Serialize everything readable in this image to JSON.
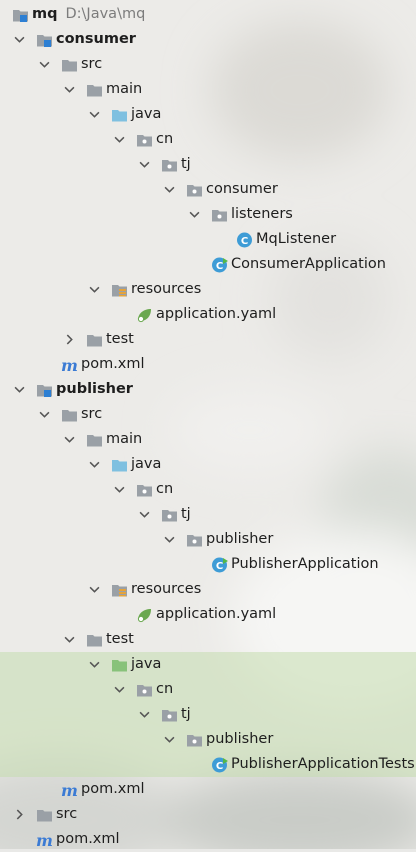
{
  "colors": {
    "folder_gray": "#9aa0a6",
    "source_blue": "#7fc0e0",
    "test_green": "#88c27a",
    "class_blue": "#3e9cd6",
    "spring_green": "#6aa84f",
    "maven_blue": "#3b7bd4",
    "highlight": "#cfe3bd"
  },
  "tree": {
    "root": {
      "label": "mq",
      "path": "D:\\Java\\mq"
    },
    "consumer": {
      "label": "consumer",
      "src": "src",
      "main": "main",
      "java": "java",
      "cn": "cn",
      "tj": "tj",
      "package": "consumer",
      "listeners": "listeners",
      "listener_class": "MqListener",
      "app_class": "ConsumerApplication",
      "resources": "resources",
      "config": "application.yaml",
      "test": "test",
      "pom": "pom.xml"
    },
    "publisher": {
      "label": "publisher",
      "src": "src",
      "main": "main",
      "java": "java",
      "cn": "cn",
      "tj": "tj",
      "package": "publisher",
      "app_class": "PublisherApplication",
      "resources": "resources",
      "config": "application.yaml",
      "test": "test",
      "test_java": "java",
      "test_cn": "cn",
      "test_tj": "tj",
      "test_package": "publisher",
      "test_class": "PublisherApplicationTests",
      "pom": "pom.xml"
    },
    "root_src": "src",
    "root_pom": "pom.xml"
  }
}
